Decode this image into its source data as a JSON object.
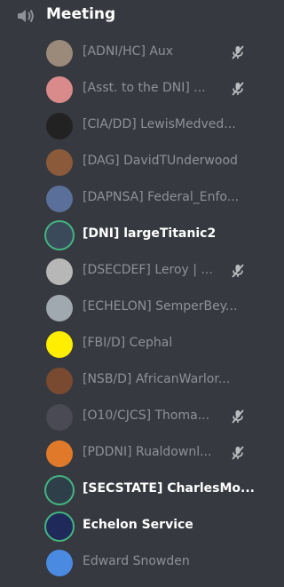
{
  "channel": {
    "name": "Meeting",
    "icon": "speaker-icon"
  },
  "users": [
    {
      "name": "[ADNI/HC] Aux",
      "muted": true,
      "active": false,
      "speaking": false,
      "avatar_color": "#9b8a7a"
    },
    {
      "name": "[Asst. to the DNI] ...",
      "muted": true,
      "active": false,
      "speaking": false,
      "avatar_color": "#d98b8b"
    },
    {
      "name": "[CIA/DD] LewisMedved...",
      "muted": false,
      "active": false,
      "speaking": false,
      "avatar_color": "#222222"
    },
    {
      "name": "[DAG] DavidTUnderwood",
      "muted": false,
      "active": false,
      "speaking": false,
      "avatar_color": "#8a5a3a"
    },
    {
      "name": "[DAPNSA] Federal_Enfo...",
      "muted": false,
      "active": false,
      "speaking": false,
      "avatar_color": "#5a6f9a"
    },
    {
      "name": "[DNI] largeTitanic2",
      "muted": false,
      "active": true,
      "speaking": true,
      "avatar_color": "#3a4a5a"
    },
    {
      "name": "[DSECDEF] Leroy | ...",
      "muted": true,
      "active": false,
      "speaking": false,
      "avatar_color": "#b7b7b7"
    },
    {
      "name": "[ECHELON] SemperBey...",
      "muted": false,
      "active": false,
      "speaking": false,
      "avatar_color": "#a0a8b0"
    },
    {
      "name": "[FBI/D] Cephal",
      "muted": false,
      "active": false,
      "speaking": false,
      "avatar_color": "#ffee00"
    },
    {
      "name": "[NSB/D] AfricanWarlor...",
      "muted": false,
      "active": false,
      "speaking": false,
      "avatar_color": "#7a4a30"
    },
    {
      "name": "[O10/CJCS] Thoma...",
      "muted": true,
      "active": false,
      "speaking": false,
      "avatar_color": "#4a4a55"
    },
    {
      "name": "[PDDNI] Rualdownl...",
      "muted": true,
      "active": false,
      "speaking": false,
      "avatar_color": "#e07a2a"
    },
    {
      "name": "[SECSTATE] CharlesMo...",
      "muted": false,
      "active": true,
      "speaking": true,
      "avatar_color": "#2f3f4a"
    },
    {
      "name": "Echelon Service",
      "muted": false,
      "active": true,
      "speaking": true,
      "avatar_color": "#1f2a5a"
    },
    {
      "name": "Edward Snowden",
      "muted": false,
      "active": false,
      "speaking": false,
      "avatar_color": "#4a8ae0"
    }
  ],
  "colors": {
    "background": "#36393f",
    "inactive_text": "#8e9297",
    "active_text": "#ffffff",
    "speaking_ring": "#43b581",
    "mute_icon": "#b9bbbe"
  }
}
